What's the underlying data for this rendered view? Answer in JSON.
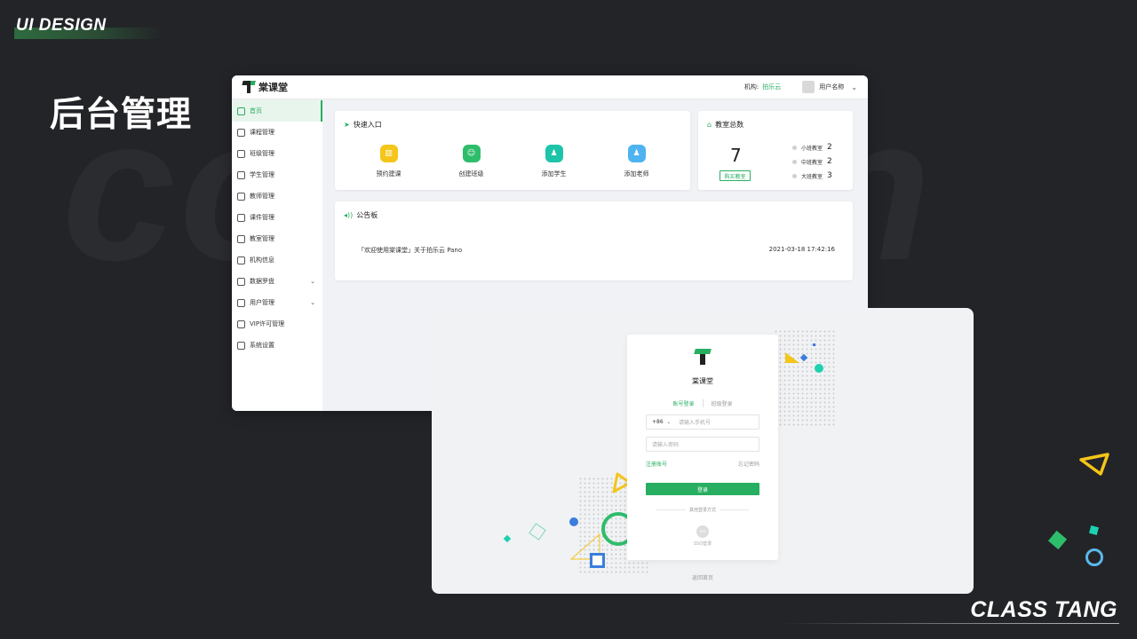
{
  "slide": {
    "tag": "UI DESIGN",
    "background_word": "common",
    "section_title": "后台管理",
    "footer": "CLASS TANG"
  },
  "colors": {
    "brand_green": "#27ae60",
    "slide_bg": "#232428",
    "accent_yellow": "#f5c518",
    "accent_cyan": "#1dd1b0",
    "accent_blue": "#3b7ddd"
  },
  "admin": {
    "header": {
      "logo_text": "棠课堂",
      "org_label": "机构:",
      "org_value": "拍乐云",
      "user_name": "用户名称"
    },
    "sidebar": [
      {
        "label": "首页",
        "icon": "home-icon",
        "active": true,
        "caret": ""
      },
      {
        "label": "课程管理",
        "icon": "course-icon",
        "active": false,
        "caret": ""
      },
      {
        "label": "班级管理",
        "icon": "class-icon",
        "active": false,
        "caret": ""
      },
      {
        "label": "学生管理",
        "icon": "student-icon",
        "active": false,
        "caret": ""
      },
      {
        "label": "教师管理",
        "icon": "teacher-icon",
        "active": false,
        "caret": ""
      },
      {
        "label": "课件管理",
        "icon": "courseware-icon",
        "active": false,
        "caret": ""
      },
      {
        "label": "教室管理",
        "icon": "classroom-icon",
        "active": false,
        "caret": ""
      },
      {
        "label": "机构信息",
        "icon": "org-icon",
        "active": false,
        "caret": ""
      },
      {
        "label": "数据罗盘",
        "icon": "compass-icon",
        "active": false,
        "caret": "⌄"
      },
      {
        "label": "用户管理",
        "icon": "users-icon",
        "active": false,
        "caret": "⌄"
      },
      {
        "label": "VIP许可管理",
        "icon": "vip-icon",
        "active": false,
        "caret": ""
      },
      {
        "label": "系统设置",
        "icon": "settings-icon",
        "active": false,
        "caret": ""
      }
    ],
    "quick_entry": {
      "title": "快速入口",
      "items": [
        {
          "label": "预约建课",
          "icon": "book-icon",
          "glyph": "▥",
          "color": "#f5c518"
        },
        {
          "label": "创建班级",
          "icon": "group-icon",
          "glyph": "☺",
          "color": "#2ebd6b"
        },
        {
          "label": "添加学生",
          "icon": "student-add-icon",
          "glyph": "♟",
          "color": "#1dc4a9"
        },
        {
          "label": "添加老师",
          "icon": "teacher-add-icon",
          "glyph": "♟",
          "color": "#4fb3f0"
        }
      ]
    },
    "rooms": {
      "title": "教室总数",
      "total": "7",
      "buy_label": "购买教室",
      "rows": [
        {
          "label": "小班教室",
          "count": "2"
        },
        {
          "label": "中班教室",
          "count": "2"
        },
        {
          "label": "大班教室",
          "count": "3"
        }
      ]
    },
    "notice": {
      "title": "公告板",
      "items": [
        {
          "text": "「欢迎使用棠课堂」关于拍乐云 Pano",
          "time": "2021-03-18 17:42:16"
        }
      ]
    }
  },
  "login": {
    "brand": "棠课堂",
    "tabs": {
      "account": "账号登录",
      "class": "班级登录"
    },
    "phone": {
      "country_code": "+86",
      "placeholder": "请输入手机号"
    },
    "password": {
      "placeholder": "请输入密码"
    },
    "register": "注册账号",
    "forgot": "忘记密码",
    "submit": "登录",
    "other_methods": "其他登录方式",
    "sso_label": "SSO登录",
    "back_home": "返回首页"
  }
}
